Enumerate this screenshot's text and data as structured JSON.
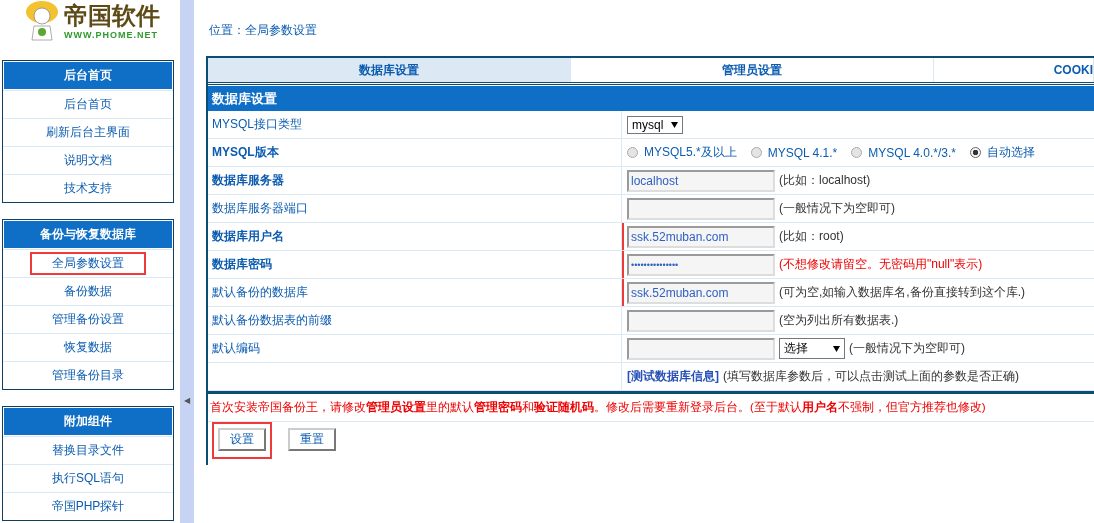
{
  "logo": {
    "title": "帝国软件",
    "url": "WWW.PHOME.NET"
  },
  "sidebar": {
    "panels": [
      {
        "title": "后台首页",
        "items": [
          {
            "label": "后台首页",
            "highlighted": false
          },
          {
            "label": "刷新后台主界面",
            "highlighted": false
          },
          {
            "label": "说明文档",
            "highlighted": false
          },
          {
            "label": "技术支持",
            "highlighted": false
          }
        ]
      },
      {
        "title": "备份与恢复数据库",
        "items": [
          {
            "label": "全局参数设置",
            "highlighted": true
          },
          {
            "label": "备份数据",
            "highlighted": false
          },
          {
            "label": "管理备份设置",
            "highlighted": false
          },
          {
            "label": "恢复数据",
            "highlighted": false
          },
          {
            "label": "管理备份目录",
            "highlighted": false
          }
        ]
      },
      {
        "title": "附加组件",
        "items": [
          {
            "label": "替换目录文件",
            "highlighted": false
          },
          {
            "label": "执行SQL语句",
            "highlighted": false
          },
          {
            "label": "帝国PHP探针",
            "highlighted": false
          }
        ]
      }
    ]
  },
  "collapse_toggle": "◀",
  "breadcrumb": "位置：全局参数设置",
  "tabs": [
    {
      "label": "数据库设置",
      "selected": true
    },
    {
      "label": "管理员设置",
      "selected": false
    },
    {
      "label": "COOKI",
      "selected": false
    }
  ],
  "section_title": "数据库设置",
  "rows": [
    {
      "kind": "select",
      "label": "MYSQL接口类型",
      "bold": false,
      "value": "mysql",
      "highlighted": false
    },
    {
      "kind": "radio",
      "label": "MYSQL版本",
      "bold": true,
      "options": [
        {
          "label": "MYSQL5.*及以上",
          "selected": false
        },
        {
          "label": "MYSQL 4.1.*",
          "selected": false
        },
        {
          "label": "MYSQL 4.0.*/3.*",
          "selected": false
        },
        {
          "label": "自动选择",
          "selected": true
        }
      ],
      "highlighted": false
    },
    {
      "kind": "text",
      "label": "数据库服务器",
      "bold": true,
      "value": "localhost",
      "hint": "(比如：localhost)",
      "warning": false,
      "highlighted": false
    },
    {
      "kind": "text",
      "label": "数据库服务器端口",
      "bold": false,
      "hint": "(一般情况下为空即可)",
      "warning": false,
      "highlighted": false
    },
    {
      "kind": "text",
      "label": "数据库用户名",
      "bold": true,
      "value": "ssk.52muban.com",
      "hint": "(比如：root)",
      "warning": false,
      "highlighted": true
    },
    {
      "kind": "password",
      "label": "数据库密码",
      "bold": true,
      "value": "•••••••••••••••",
      "hint": "(不想修改请留空。无密码用\"null\"表示)",
      "warning": true,
      "highlighted": true
    },
    {
      "kind": "text",
      "label": "默认备份的数据库",
      "bold": false,
      "value": "ssk.52muban.com",
      "hint": "(可为空,如输入数据库名,备份直接转到这个库.)",
      "warning": false,
      "highlighted": true
    },
    {
      "kind": "text",
      "label": "默认备份数据表的前缀",
      "bold": false,
      "hint": "(空为列出所有数据表.)",
      "warning": false,
      "highlighted": false
    },
    {
      "kind": "text_select",
      "label": "默认编码",
      "bold": false,
      "select": "选择",
      "hint": "(一般情况下为空即可)",
      "warning": false,
      "highlighted": false
    },
    {
      "kind": "link",
      "link": "[测试数据库信息]",
      "hint": "(填写数据库参数后，可以点击测试上面的参数是否正确)",
      "highlighted": false
    }
  ],
  "notice": "首次安装帝国备份王，请修改**管理员设置**里的默认**管理密码**和**验证随机码**。修改后需要重新登录后台。(至于默认**用户名**不强制，但官方推荐也修改)",
  "buttons": [
    {
      "label": "设置",
      "highlighted": true
    },
    {
      "label": "重置",
      "highlighted": false
    }
  ]
}
